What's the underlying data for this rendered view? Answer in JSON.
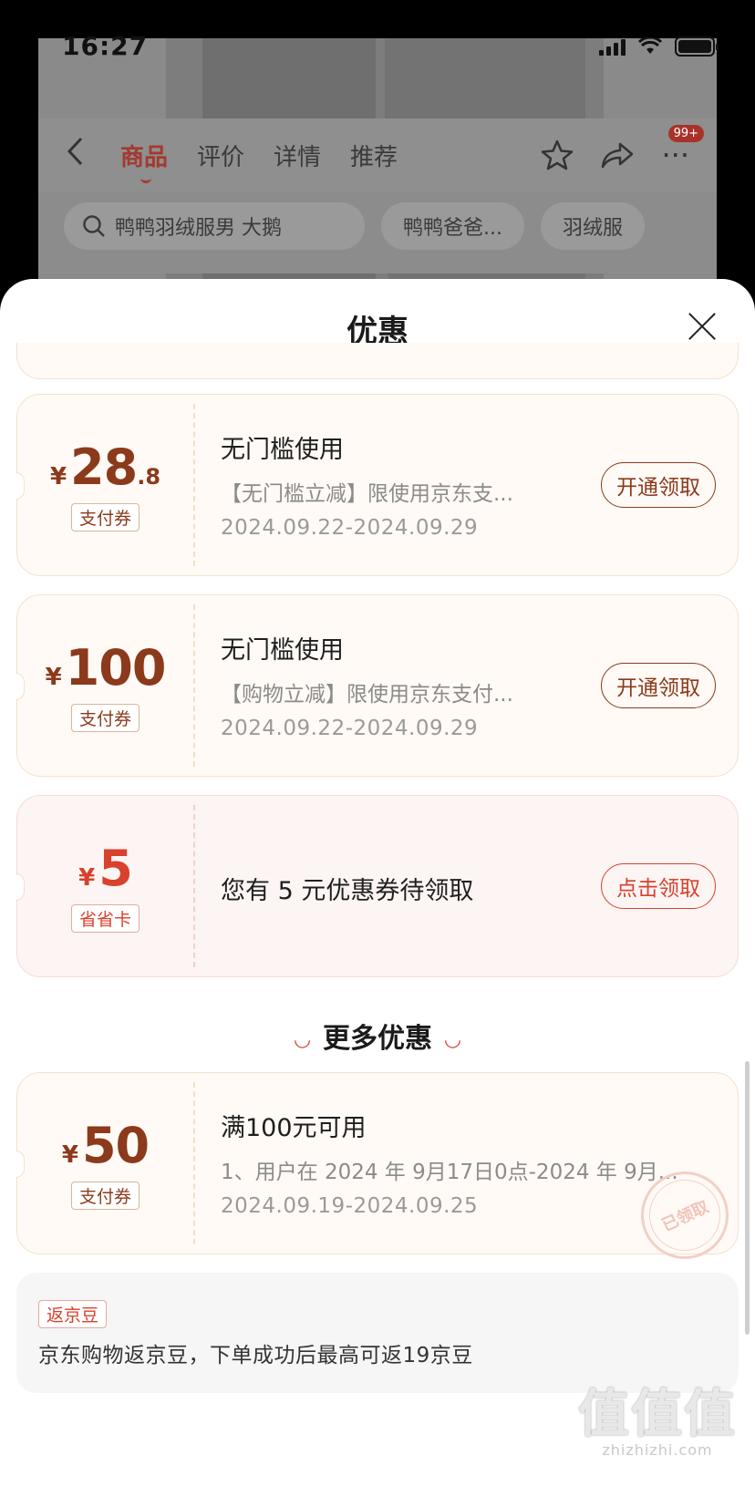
{
  "status_bar": {
    "time": "16:27"
  },
  "nav": {
    "back_icon": "chevron-left-icon",
    "tabs": [
      {
        "label": "商品",
        "active": true
      },
      {
        "label": "评价",
        "active": false
      },
      {
        "label": "详情",
        "active": false
      },
      {
        "label": "推荐",
        "active": false
      }
    ],
    "badge": "99+"
  },
  "search": {
    "query": "鸭鸭羽绒服男 大鹅",
    "chips": [
      "鸭鸭爸爸...",
      "羽绒服"
    ]
  },
  "sheet": {
    "title": "优惠",
    "coupons": [
      {
        "currency": "¥",
        "amount_int": "28",
        "amount_dec": ".8",
        "tag": "支付券",
        "title": "无门槛使用",
        "desc": "【无门槛立减】限使用京东支...",
        "date": "2024.09.22-2024.09.29",
        "button": "开通领取"
      },
      {
        "currency": "¥",
        "amount_int": "100",
        "amount_dec": "",
        "tag": "支付券",
        "title": "无门槛使用",
        "desc": "【购物立减】限使用京东支付...",
        "date": "2024.09.22-2024.09.29",
        "button": "开通领取"
      },
      {
        "currency": "¥",
        "amount_int": "5",
        "amount_dec": "",
        "tag": "省省卡",
        "text": "您有 5 元优惠券待领取",
        "button": "点击领取"
      }
    ],
    "more_header": "更多优惠",
    "more_coupons": [
      {
        "currency": "¥",
        "amount_int": "50",
        "amount_dec": "",
        "tag": "支付券",
        "title": "满100元可用",
        "desc": "1、用户在 2024 年 9月17日0点-2024 年 9月...",
        "date": "2024.09.19-2024.09.25",
        "stamp": "已领取"
      }
    ],
    "bean": {
      "tag": "返京豆",
      "text": "京东购物返京豆，下单成功后最高可返19京豆"
    }
  },
  "watermark": {
    "logo": "值值值",
    "site": "zhizhizhi.com"
  }
}
